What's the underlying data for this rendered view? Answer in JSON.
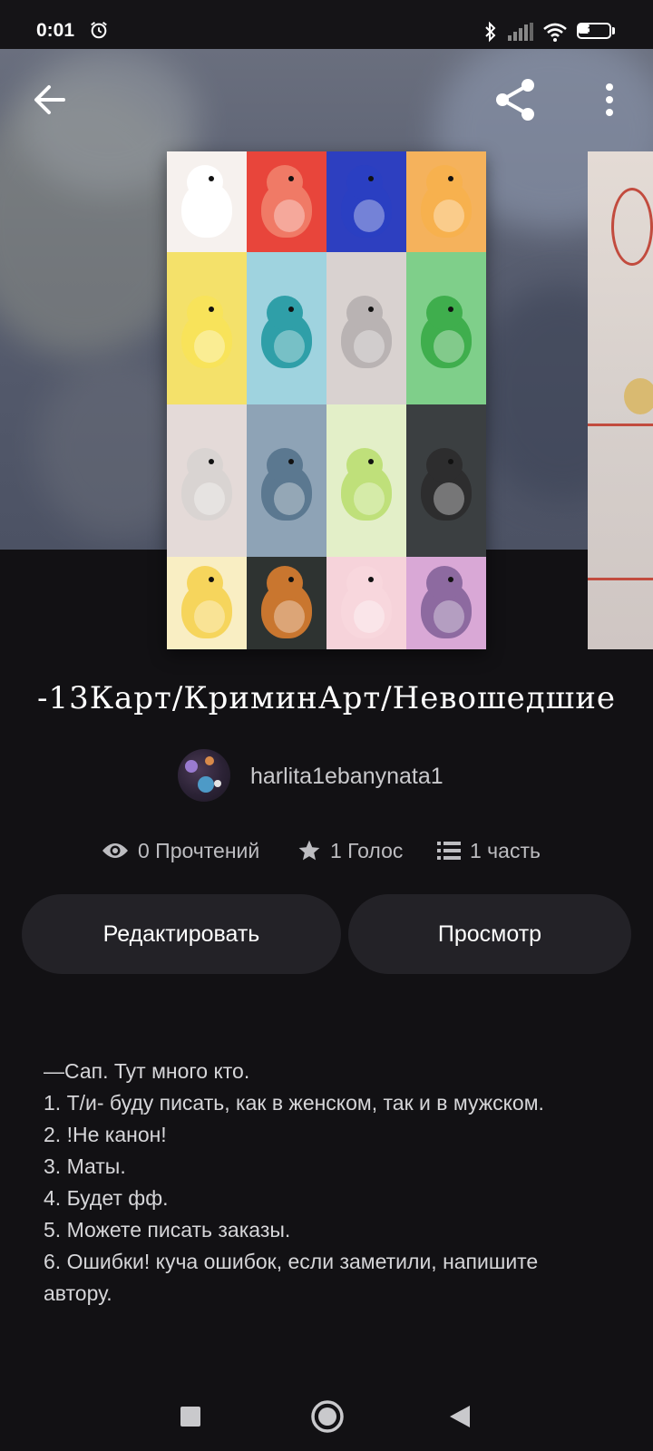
{
  "status_bar": {
    "time": "0:01",
    "battery": "36",
    "battery_level": 0.36
  },
  "toolbar": {
    "back_icon": "arrow-left-icon",
    "share_icon": "share-icon",
    "more_icon": "more-vertical-icon"
  },
  "story": {
    "title": "-13Карт/КриминАрт/Невошедшие",
    "author": "harlita1ebanynata1",
    "stats": {
      "reads": "0 Прочтений",
      "votes": "1 Голос",
      "parts": "1 часть"
    }
  },
  "actions": {
    "edit_label": "Редактировать",
    "view_label": "Просмотр"
  },
  "description": [
    "—Сап. Тут много кто.",
    "1. Т/и- буду писать, как в женском, так и в мужском.",
    "2. !Не канон!",
    "3. Маты.",
    "4. Будет фф.",
    "5. Можете писать заказы.",
    "6. Ошибки! куча ошибок, если заметили, напишите автору."
  ],
  "colors": {
    "background": "#121114",
    "button_bg": "#232227",
    "cover_tiles": [
      "#f6f1ee",
      "#e8453b",
      "#2d3fc0",
      "#f5b25c",
      "#f4e16a",
      "#9fd3df",
      "#d9d2d0",
      "#7fcf8a",
      "#e4dad8",
      "#8ea3b6",
      "#e3efc8",
      "#3b3f41",
      "#f9eec3",
      "#2e3331",
      "#f6d3da",
      "#d9a8d6"
    ],
    "bird_colors": [
      "#ffffff",
      "#f07a66",
      "#2a3fc2",
      "#f7b14e",
      "#f8e35a",
      "#2f9fa8",
      "#b9b3b3",
      "#3fae4d",
      "#d9d4d2",
      "#5b7890",
      "#bfe07a",
      "#2d2d2e",
      "#f6d55c",
      "#c9762f",
      "#f8d7dd",
      "#8d6aa0"
    ]
  },
  "nav": {
    "recents_icon": "square-icon",
    "home_icon": "circle-home-icon",
    "back_icon": "triangle-back-icon"
  }
}
